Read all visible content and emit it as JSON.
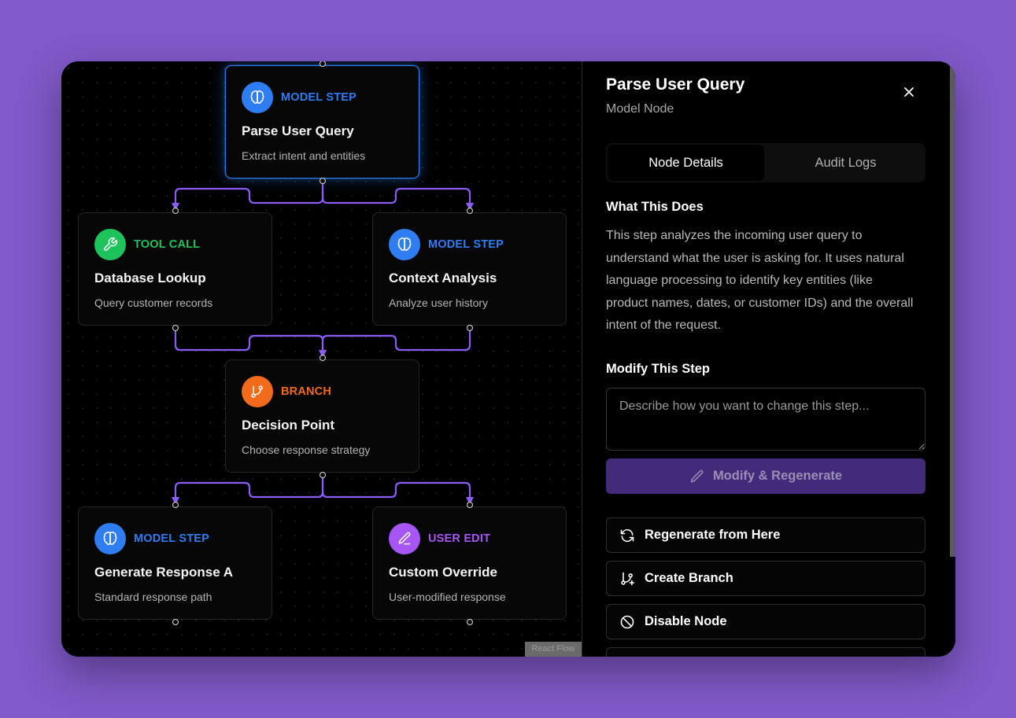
{
  "colors": {
    "background": "#8159c9",
    "model": "#2f7df3",
    "tool": "#1ec45b",
    "branch": "#f26a1b",
    "user": "#a855f7",
    "edge": "#8b5cf6"
  },
  "nodes": [
    {
      "id": "parse",
      "kind": "MODEL STEP",
      "kind_type": "model",
      "icon": "brain-icon",
      "title": "Parse User Query",
      "subtitle": "Extract intent and entities",
      "selected": true
    },
    {
      "id": "db",
      "kind": "TOOL CALL",
      "kind_type": "tool",
      "icon": "wrench-icon",
      "title": "Database Lookup",
      "subtitle": "Query customer records"
    },
    {
      "id": "context",
      "kind": "MODEL STEP",
      "kind_type": "model",
      "icon": "brain-icon",
      "title": "Context Analysis",
      "subtitle": "Analyze user history"
    },
    {
      "id": "decision",
      "kind": "BRANCH",
      "kind_type": "branch",
      "icon": "git-branch-icon",
      "title": "Decision Point",
      "subtitle": "Choose response strategy"
    },
    {
      "id": "genA",
      "kind": "MODEL STEP",
      "kind_type": "model",
      "icon": "brain-icon",
      "title": "Generate Response A",
      "subtitle": "Standard response path"
    },
    {
      "id": "custom",
      "kind": "USER EDIT",
      "kind_type": "user",
      "icon": "pencil-icon",
      "title": "Custom Override",
      "subtitle": "User-modified response"
    }
  ],
  "canvas": {
    "watermark": "React Flow"
  },
  "panel": {
    "title": "Parse User Query",
    "subtitle": "Model Node",
    "close_icon": "close-icon",
    "tabs": [
      {
        "label": "Node Details",
        "active": true
      },
      {
        "label": "Audit Logs",
        "active": false
      }
    ],
    "what_heading": "What This Does",
    "what_body": "This step analyzes the incoming user query to understand what the user is asking for. It uses natural language processing to identify key entities (like product names, dates, or customer IDs) and the overall intent of the request.",
    "modify_heading": "Modify This Step",
    "modify_placeholder": "Describe how you want to change this step...",
    "modify_value": "",
    "regenerate_label": "Modify & Regenerate",
    "actions": [
      {
        "label": "Regenerate from Here",
        "icon": "refresh-icon"
      },
      {
        "label": "Create Branch",
        "icon": "git-branch-plus-icon"
      },
      {
        "label": "Disable Node",
        "icon": "ban-icon"
      }
    ]
  }
}
